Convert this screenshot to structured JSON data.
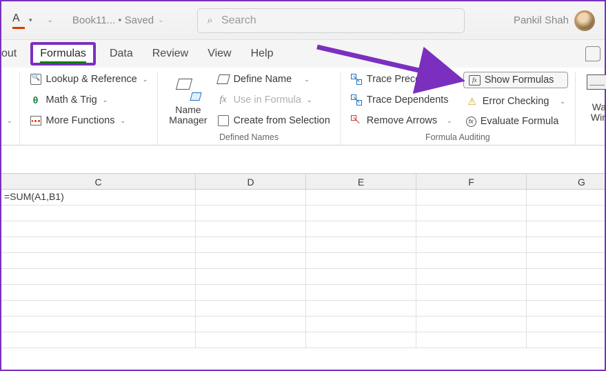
{
  "titlebar": {
    "font_letter": "A",
    "filename": "Book11...",
    "saved": "• Saved",
    "search_placeholder": "Search",
    "username": "Pankil Shah"
  },
  "tabs": {
    "cut_left": "out",
    "active": "Formulas",
    "data": "Data",
    "review": "Review",
    "view": "View",
    "help": "Help"
  },
  "ribbon": {
    "func_lib": {
      "lookup": "Lookup & Reference",
      "math": "Math & Trig",
      "more": "More Functions"
    },
    "defined_names": {
      "name_manager": "Name\nManager",
      "define_name": "Define Name",
      "use_in_formula": "Use in Formula",
      "create_from_sel": "Create from Selection",
      "group_label": "Defined Names"
    },
    "auditing": {
      "trace_prec": "Trace Precedents",
      "trace_dep": "Trace Dependents",
      "remove_arrows": "Remove Arrows",
      "show_formulas": "Show Formulas",
      "error_checking": "Error Checking",
      "eval_formula": "Evaluate Formula",
      "group_label": "Formula Auditing"
    },
    "watch": {
      "watch_window": "Wa",
      "watch_window2": "Win"
    }
  },
  "grid": {
    "columns": [
      "C",
      "D",
      "E",
      "F",
      "G"
    ],
    "cell_c1": "=SUM(A1,B1)"
  }
}
